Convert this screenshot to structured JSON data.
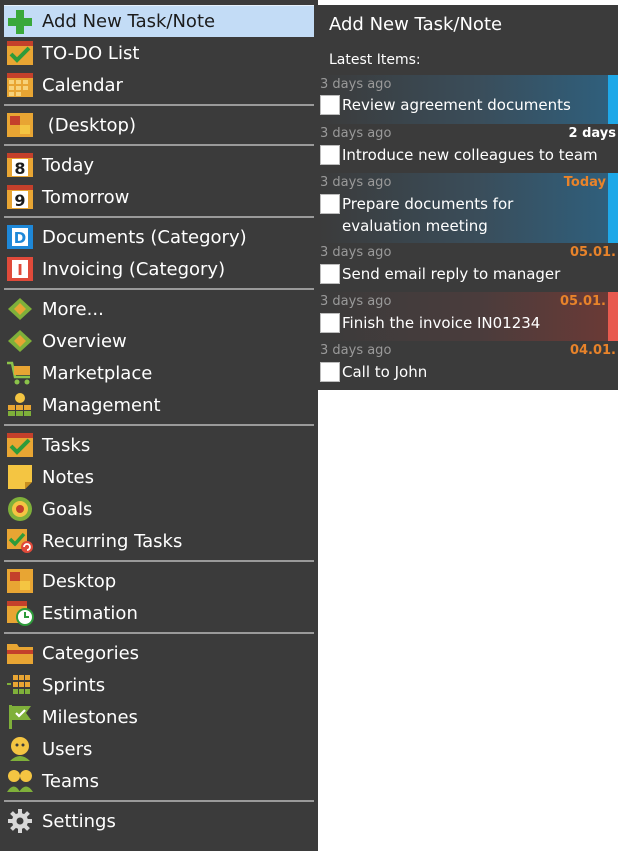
{
  "menu": {
    "items": [
      {
        "label": "Add New Task/Note",
        "icon": "plus-icon"
      },
      {
        "label": "TO-DO List",
        "icon": "todo-list-icon"
      },
      {
        "label": "Calendar",
        "icon": "calendar-icon"
      },
      {
        "label": " (Desktop)",
        "icon": "desktop-icon"
      },
      {
        "label": "Today",
        "icon": "today-icon",
        "icon_text": "8"
      },
      {
        "label": "Tomorrow",
        "icon": "tomorrow-icon",
        "icon_text": "9"
      },
      {
        "label": "Documents (Category)",
        "icon": "category-d-icon",
        "icon_text": "D"
      },
      {
        "label": "Invoicing (Category)",
        "icon": "category-i-icon",
        "icon_text": "I"
      },
      {
        "label": "More...",
        "icon": "more-icon"
      },
      {
        "label": "Overview",
        "icon": "overview-icon"
      },
      {
        "label": "Marketplace",
        "icon": "marketplace-cart-icon"
      },
      {
        "label": "Management",
        "icon": "management-icon"
      },
      {
        "label": "Tasks",
        "icon": "tasks-icon"
      },
      {
        "label": "Notes",
        "icon": "notes-icon"
      },
      {
        "label": "Goals",
        "icon": "goals-target-icon"
      },
      {
        "label": "Recurring Tasks",
        "icon": "recurring-tasks-icon"
      },
      {
        "label": "Desktop",
        "icon": "desktop-icon"
      },
      {
        "label": "Estimation",
        "icon": "estimation-clock-icon"
      },
      {
        "label": "Categories",
        "icon": "categories-folder-icon"
      },
      {
        "label": "Sprints",
        "icon": "sprints-icon"
      },
      {
        "label": "Milestones",
        "icon": "milestones-flag-icon"
      },
      {
        "label": "Users",
        "icon": "user-icon"
      },
      {
        "label": "Teams",
        "icon": "team-icon"
      },
      {
        "label": "Settings",
        "icon": "gear-icon"
      }
    ],
    "selected_index": 0
  },
  "panel": {
    "title": "Add New Task/Note",
    "latest_label": "Latest Items:",
    "tasks": [
      {
        "ago": "3 days ago",
        "title": "Review agreement documents",
        "due": "",
        "checked": false,
        "bar_color": "#1ea8e8"
      },
      {
        "ago": "3 days ago",
        "title": "Introduce new colleagues to team",
        "due": "2 days",
        "due_color": "#ffffff",
        "checked": false
      },
      {
        "ago": "3 days ago",
        "title": "Prepare documents for evaluation meeting",
        "due": "Today",
        "due_color": "#e8832a",
        "checked": false,
        "bar_color": "#1ea8e8"
      },
      {
        "ago": "3 days ago",
        "title": "Send email reply to manager",
        "due": "05.01.",
        "due_color": "#e8832a",
        "checked": false
      },
      {
        "ago": "3 days ago",
        "title": "Finish the invoice IN01234",
        "due": "05.01.",
        "due_color": "#e8832a",
        "checked": false,
        "bar_color": "#e85a4f"
      },
      {
        "ago": "3 days ago",
        "title": "Call to John",
        "due": "04.01.",
        "due_color": "#e8832a",
        "checked": false
      }
    ]
  },
  "colors": {
    "menu_bg": "#3b3b3b",
    "selected_bg": "#c3dcf6",
    "separator": "#9a9a9a",
    "accent_blue": "#1ea8e8",
    "accent_red": "#e85a4f",
    "due_orange": "#e8832a"
  }
}
